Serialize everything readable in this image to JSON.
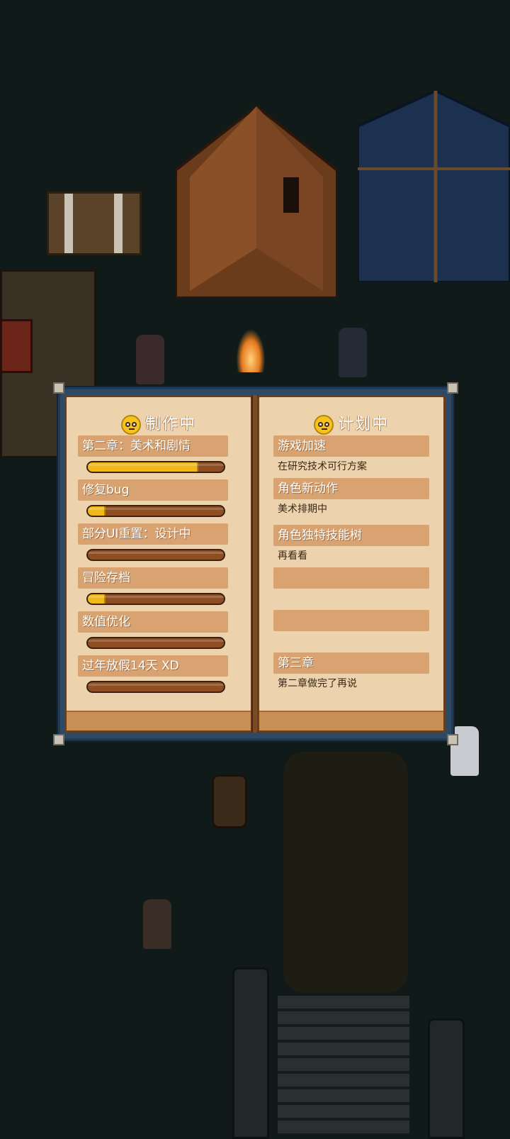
{
  "colors": {
    "background": "#0f1a19",
    "page": "#ecd3ae",
    "label_band": "#d9a371",
    "bar_track": "#8e4e22",
    "bar_fill": "#f2b81a"
  },
  "book": {
    "left_page": {
      "title": "制作中",
      "icon": "neutral-face-icon",
      "items": [
        {
          "label": "第二章：美术和剧情",
          "progress": 0.8
        },
        {
          "label": "修复bug",
          "progress": 0.12
        },
        {
          "label": "部分UI重置：设计中",
          "progress": 0.0
        },
        {
          "label": "冒险存档",
          "progress": 0.12
        },
        {
          "label": "数值优化",
          "progress": 0.0
        },
        {
          "label": "过年放假14天 XD",
          "progress": 0.0
        }
      ]
    },
    "right_page": {
      "title": "计划中",
      "icon": "neutral-face-icon",
      "items": [
        {
          "label": "游戏加速",
          "note": "在研究技术可行方案"
        },
        {
          "label": "角色新动作",
          "note": "美术排期中"
        },
        {
          "label": "角色独特技能树",
          "note": "再看看"
        },
        {
          "label": "",
          "note": ""
        },
        {
          "label": "",
          "note": ""
        },
        {
          "label": "第三章",
          "note": "第二章做完了再说"
        }
      ]
    }
  }
}
